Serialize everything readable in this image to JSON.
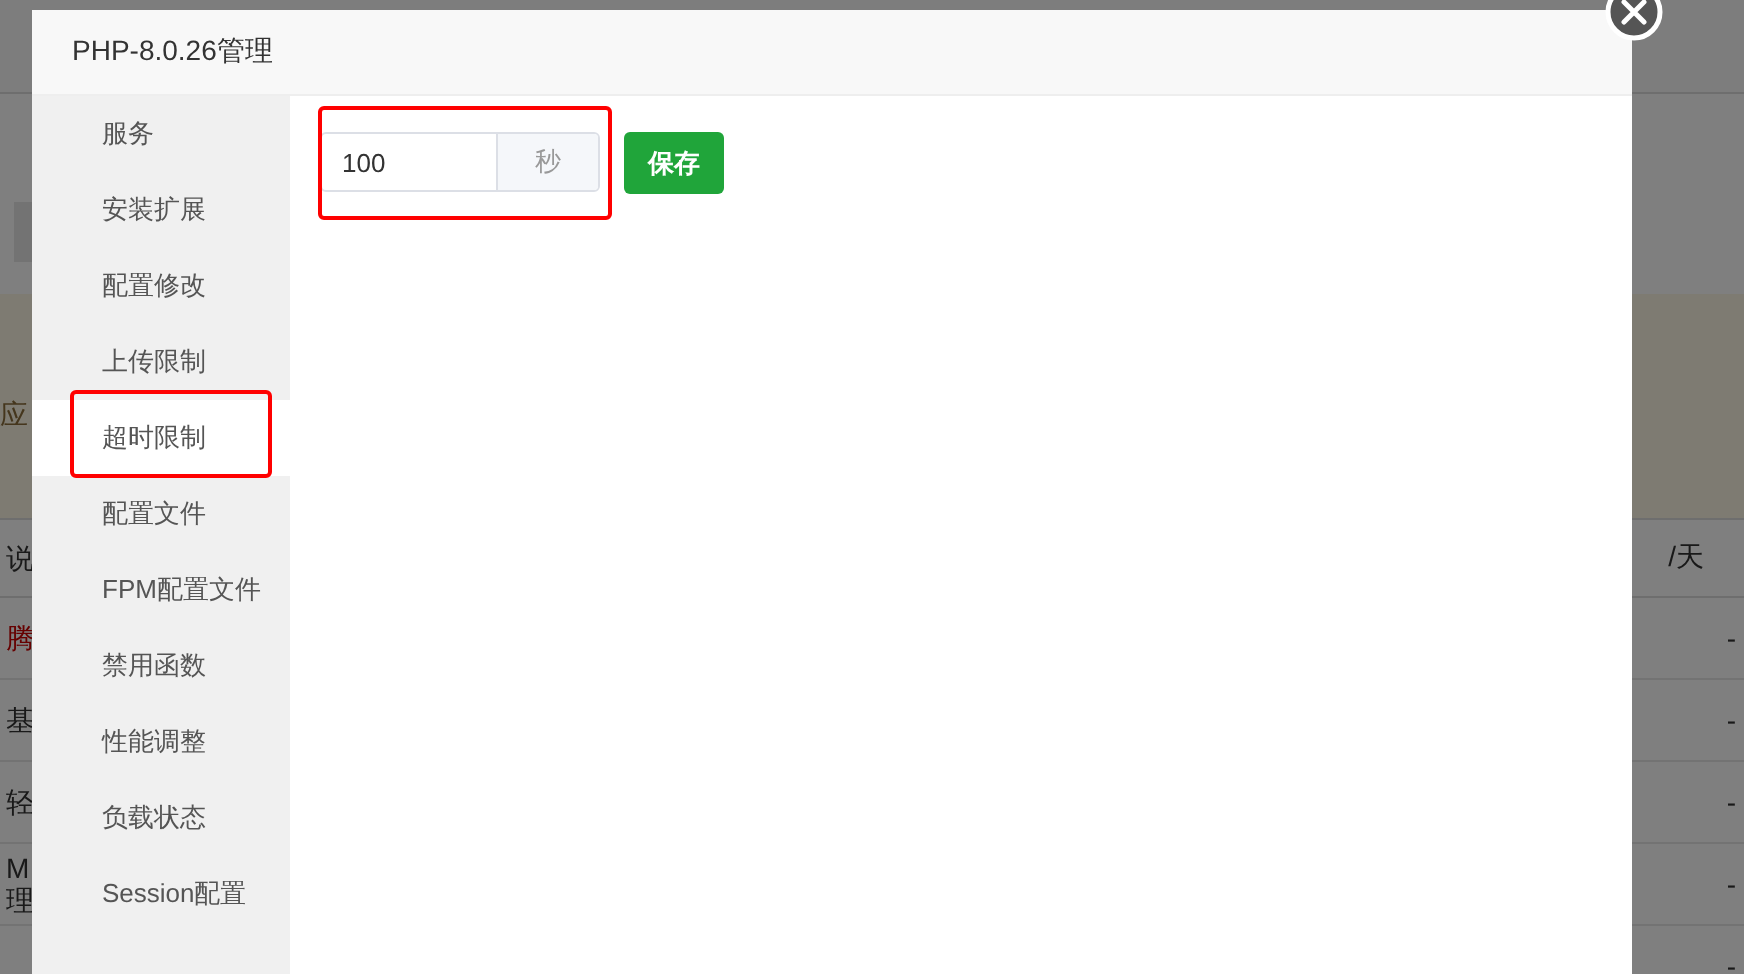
{
  "background": {
    "notice": "应",
    "table": {
      "header": [
        "说",
        "/天"
      ],
      "rows": [
        {
          "kind": "link",
          "lines": [
            "腾"
          ],
          "value": "-"
        },
        {
          "kind": "plain",
          "lines": [
            "基"
          ],
          "value": "-"
        },
        {
          "kind": "plain",
          "lines": [
            "轻"
          ],
          "value": "-"
        },
        {
          "kind": "plain",
          "lines": [
            "M",
            "理"
          ],
          "value": "-"
        },
        {
          "kind": "plain",
          "value": "-"
        }
      ]
    }
  },
  "dialog": {
    "title": "PHP-8.0.26管理",
    "menu": [
      {
        "label": "服务",
        "selected": false,
        "highlighted": false
      },
      {
        "label": "安装扩展",
        "selected": false,
        "highlighted": false
      },
      {
        "label": "配置修改",
        "selected": false,
        "highlighted": false
      },
      {
        "label": "上传限制",
        "selected": false,
        "highlighted": false
      },
      {
        "label": "超时限制",
        "selected": true,
        "highlighted": true
      },
      {
        "label": "配置文件",
        "selected": false,
        "highlighted": false
      },
      {
        "label": "FPM配置文件",
        "selected": false,
        "highlighted": false
      },
      {
        "label": "禁用函数",
        "selected": false,
        "highlighted": false
      },
      {
        "label": "性能调整",
        "selected": false,
        "highlighted": false
      },
      {
        "label": "负载状态",
        "selected": false,
        "highlighted": false
      },
      {
        "label": "Session配置",
        "selected": false,
        "highlighted": false
      }
    ],
    "timeout": {
      "value": "100",
      "unit": "秒",
      "highlighted": true
    },
    "save_button": "保存"
  }
}
